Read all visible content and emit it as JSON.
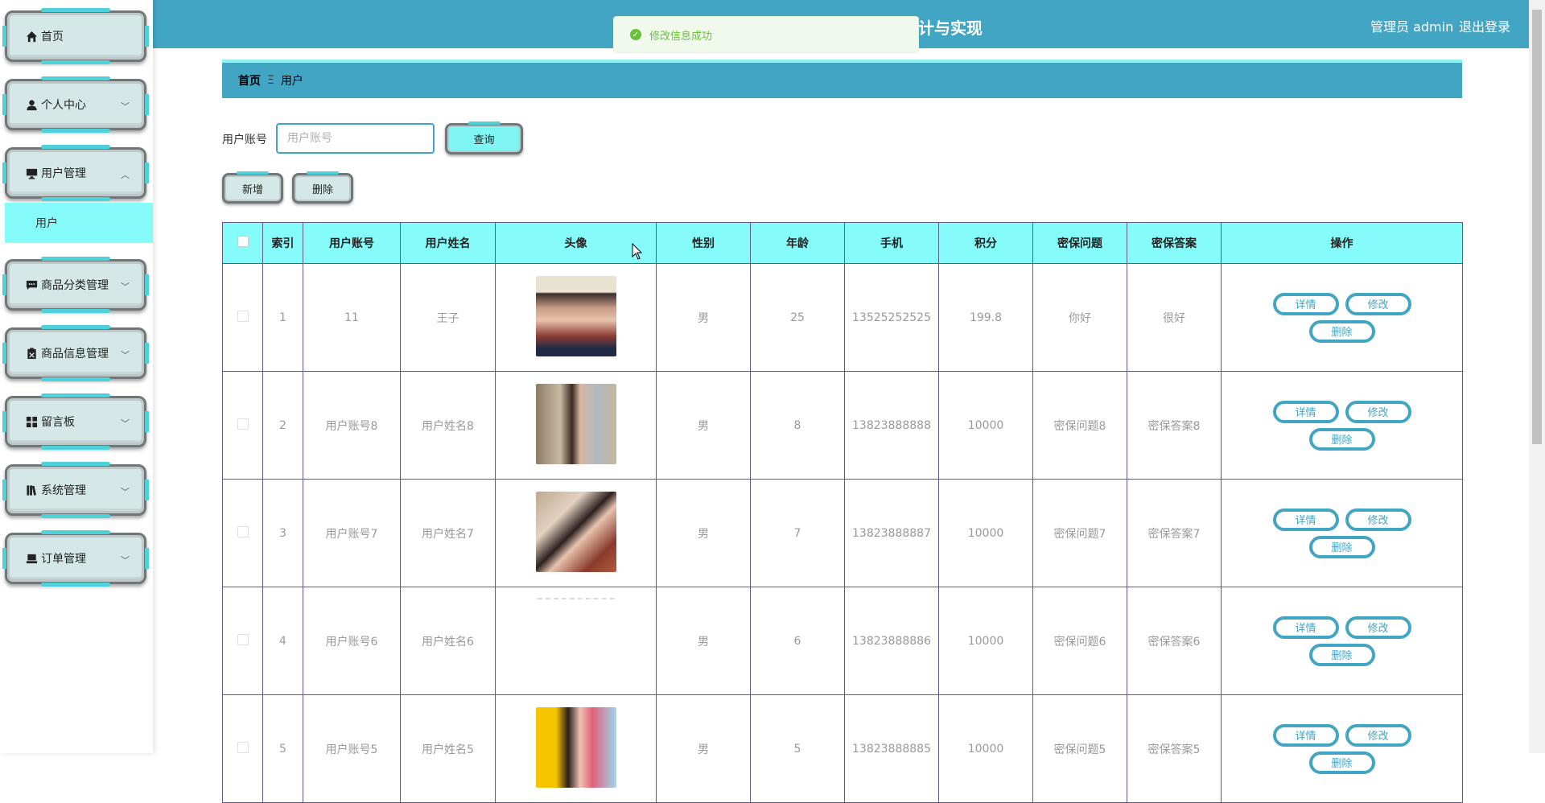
{
  "sidebar": {
    "items": [
      {
        "label": "首页",
        "icon": "home-icon"
      },
      {
        "label": "个人中心",
        "icon": "user-icon"
      },
      {
        "label": "用户管理",
        "icon": "monitor-icon"
      },
      {
        "label": "商品分类管理",
        "icon": "chat-icon"
      },
      {
        "label": "商品信息管理",
        "icon": "clipboard-icon"
      },
      {
        "label": "留言板",
        "icon": "grid-icon"
      },
      {
        "label": "系统管理",
        "icon": "book-icon"
      },
      {
        "label": "订单管理",
        "icon": "laptop-icon"
      }
    ],
    "submenu": {
      "label": "用户"
    }
  },
  "header": {
    "title": "计与实现",
    "user": "管理员 admin",
    "logout": "退出登录",
    "toast": "修改信息成功"
  },
  "breadcrumb": {
    "home": "首页",
    "separator": "Ξ",
    "current": "用户"
  },
  "search": {
    "label": "用户账号",
    "placeholder": "用户账号",
    "query_button": "查询"
  },
  "toolbar": {
    "add": "新增",
    "delete": "删除"
  },
  "table": {
    "headers": [
      "索引",
      "用户账号",
      "用户姓名",
      "头像",
      "性别",
      "年龄",
      "手机",
      "积分",
      "密保问题",
      "密保答案",
      "操作"
    ],
    "actions": {
      "detail": "详情",
      "edit": "修改",
      "delete": "删除"
    },
    "rows": [
      {
        "index": "1",
        "account": "11",
        "name": "王子",
        "avatar": "avatar-boy",
        "gender": "男",
        "age": "25",
        "phone": "13525252525",
        "points": "199.8",
        "question": "你好",
        "answer": "很好"
      },
      {
        "index": "2",
        "account": "用户账号8",
        "name": "用户姓名8",
        "avatar": "avatar-girl-street",
        "gender": "男",
        "age": "8",
        "phone": "13823888888",
        "points": "10000",
        "question": "密保问题8",
        "answer": "密保答案8"
      },
      {
        "index": "3",
        "account": "用户账号7",
        "name": "用户姓名7",
        "avatar": "avatar-girl-hair",
        "gender": "男",
        "age": "7",
        "phone": "13823888887",
        "points": "10000",
        "question": "密保问题7",
        "answer": "密保答案7"
      },
      {
        "index": "4",
        "account": "用户账号6",
        "name": "用户姓名6",
        "avatar": "avatar-blank",
        "gender": "男",
        "age": "6",
        "phone": "13823888886",
        "points": "10000",
        "question": "密保问题6",
        "answer": "密保答案6"
      },
      {
        "index": "5",
        "account": "用户账号5",
        "name": "用户姓名5",
        "avatar": "avatar-girl-yellow",
        "gender": "男",
        "age": "5",
        "phone": "13823888885",
        "points": "10000",
        "question": "密保问题5",
        "answer": "密保答案5"
      }
    ]
  },
  "colors": {
    "primary": "#42a5c4",
    "accent": "#86fcfa",
    "success": "#67c23a"
  }
}
